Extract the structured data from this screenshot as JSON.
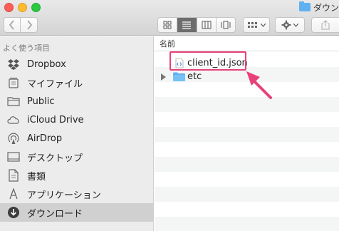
{
  "window": {
    "title": "ダウン"
  },
  "toolbar": {
    "back_icon": "chevron-left-icon",
    "forward_icon": "chevron-right-icon",
    "view_modes": [
      "icon-view-icon",
      "list-view-icon",
      "column-view-icon",
      "coverflow-view-icon"
    ],
    "active_view": "list-view-icon",
    "arrange_icon": "arrange-grid-icon",
    "action_icon": "gear-icon",
    "share_icon": "share-icon"
  },
  "sidebar": {
    "heading": "よく使う項目",
    "items": [
      {
        "label": "Dropbox",
        "icon": "dropbox-icon"
      },
      {
        "label": "マイファイル",
        "icon": "all-my-files-icon"
      },
      {
        "label": "Public",
        "icon": "folder-icon"
      },
      {
        "label": "iCloud Drive",
        "icon": "cloud-icon"
      },
      {
        "label": "AirDrop",
        "icon": "airdrop-icon"
      },
      {
        "label": "デスクトップ",
        "icon": "desktop-icon"
      },
      {
        "label": "書類",
        "icon": "documents-icon"
      },
      {
        "label": "アプリケーション",
        "icon": "applications-icon"
      },
      {
        "label": "ダウンロード",
        "icon": "downloads-icon",
        "selected": true
      }
    ]
  },
  "content": {
    "column_header": "名前",
    "files": [
      {
        "name": "client_id.json",
        "icon": "json-file-icon",
        "highlighted": true
      },
      {
        "name": "etc",
        "icon": "folder-icon",
        "collapsed": true
      }
    ]
  },
  "annotation": {
    "color": "#e8417a"
  }
}
